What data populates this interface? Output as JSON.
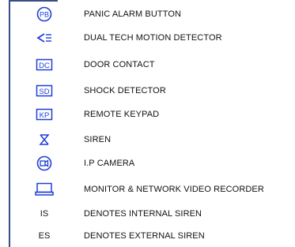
{
  "legend": {
    "items": [
      {
        "icon": "panic-alarm-icon",
        "icon_text": "PB",
        "label": "PANIC ALARM BUTTON"
      },
      {
        "icon": "motion-detector-icon",
        "icon_text": "",
        "label": "DUAL TECH MOTION DETECTOR"
      },
      {
        "icon": "door-contact-icon",
        "icon_text": "DC",
        "label": "DOOR CONTACT"
      },
      {
        "icon": "shock-detector-icon",
        "icon_text": "SD",
        "label": "SHOCK DETECTOR"
      },
      {
        "icon": "remote-keypad-icon",
        "icon_text": "KP",
        "label": "REMOTE KEYPAD"
      },
      {
        "icon": "siren-icon",
        "icon_text": "",
        "label": "SIREN"
      },
      {
        "icon": "ip-camera-icon",
        "icon_text": "",
        "label": "I.P CAMERA"
      },
      {
        "icon": "monitor-nvr-icon",
        "icon_text": "",
        "label": "MONITOR & NETWORK VIDEO RECORDER"
      },
      {
        "icon": "internal-siren-icon",
        "icon_text": "IS",
        "label": "DENOTES INTERNAL SIREN"
      },
      {
        "icon": "external-siren-icon",
        "icon_text": "ES",
        "label": "DENOTES EXTERNAL SIREN"
      }
    ]
  },
  "colors": {
    "icon_blue": "#1f3fd6",
    "border": "#3b4d86",
    "text": "#111111"
  }
}
